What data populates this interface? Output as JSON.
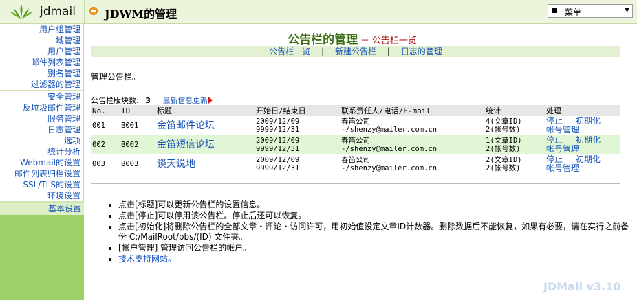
{
  "app": {
    "logo_text": "jdmail",
    "page_title": "JDWM的管理",
    "menu_select_value": "菜单",
    "version": "JDMail v3.10"
  },
  "sidebar": {
    "group1": [
      "用户组管理",
      "域管理",
      "用户管理",
      "邮件列表管理",
      "别名管理",
      "过滤器的管理"
    ],
    "group2": [
      "安全管理",
      "反垃圾邮件管理",
      "服务管理",
      "日志管理",
      "选项",
      "统计分析",
      "Webmail的设置",
      "邮件列表归档设置",
      "SSL/TLS的设置",
      "环境设置"
    ],
    "basic": "基本设置"
  },
  "main": {
    "heading": "公告栏的管理",
    "subheading": "公告栏一览",
    "heading_dash": "－",
    "nav": [
      "公告栏一览",
      "新建公告栏",
      "日志的管理"
    ],
    "nav_sep": "|",
    "intro": "管理公告栏。",
    "count_label": "公告栏版块数:",
    "count_value": "3",
    "latest_link": "最新信息更新"
  },
  "table": {
    "headers": [
      "No.",
      "ID",
      "标题",
      "开始日/结束日",
      "联系责任人/电话/E-mail",
      "统计",
      "处理"
    ],
    "rows": [
      {
        "no": "001",
        "id": "B001",
        "title": "金笛邮件论坛",
        "start": "2009/12/09",
        "end": "9999/12/31",
        "contact_name": "春笛公司",
        "contact_detail": "-/shenzy@mailer.com.cn",
        "stat1": "4(文章ID)",
        "stat2": "2(帐号数)",
        "op_stop": "停止",
        "op_init": "初期化",
        "op_account": "帐号管理"
      },
      {
        "no": "002",
        "id": "B002",
        "title": "金笛短信论坛",
        "start": "2009/12/09",
        "end": "9999/12/31",
        "contact_name": "春笛公司",
        "contact_detail": "-/shenzy@mailer.com.cn",
        "stat1": "1(文章ID)",
        "stat2": "2(帐号数)",
        "op_stop": "停止",
        "op_init": "初期化",
        "op_account": "帐号管理"
      },
      {
        "no": "003",
        "id": "B003",
        "title": "谈天说地",
        "start": "2009/12/09",
        "end": "9999/12/31",
        "contact_name": "春笛公司",
        "contact_detail": "-/shenzy@mailer.com.cn",
        "stat1": "2(文章ID)",
        "stat2": "2(帐号数)",
        "op_stop": "停止",
        "op_init": "初期化",
        "op_account": "帐号管理"
      }
    ]
  },
  "notes": [
    "点击[标题]可以更新公告栏的设置信息。",
    "点击[停止]可以停用该公告栏。停止后还可以恢复。",
    "点击[初始化]将删除公告栏的全部文章・评论・访问许可，用初始值设定文章ID计数器。删除数据后不能恢复，如果有必要，请在实行之前备份 C:/MailRoot/bbs/(ID) 文件夹。",
    "[帐户管理] 管理访问公告栏的帐户。"
  ],
  "support_link": "技术支持网站。",
  "colors": {
    "link": "#1a55b8",
    "sidebar": "#9fd16b",
    "heading": "#3c6e11",
    "row_alt": "#e1f6d4"
  }
}
